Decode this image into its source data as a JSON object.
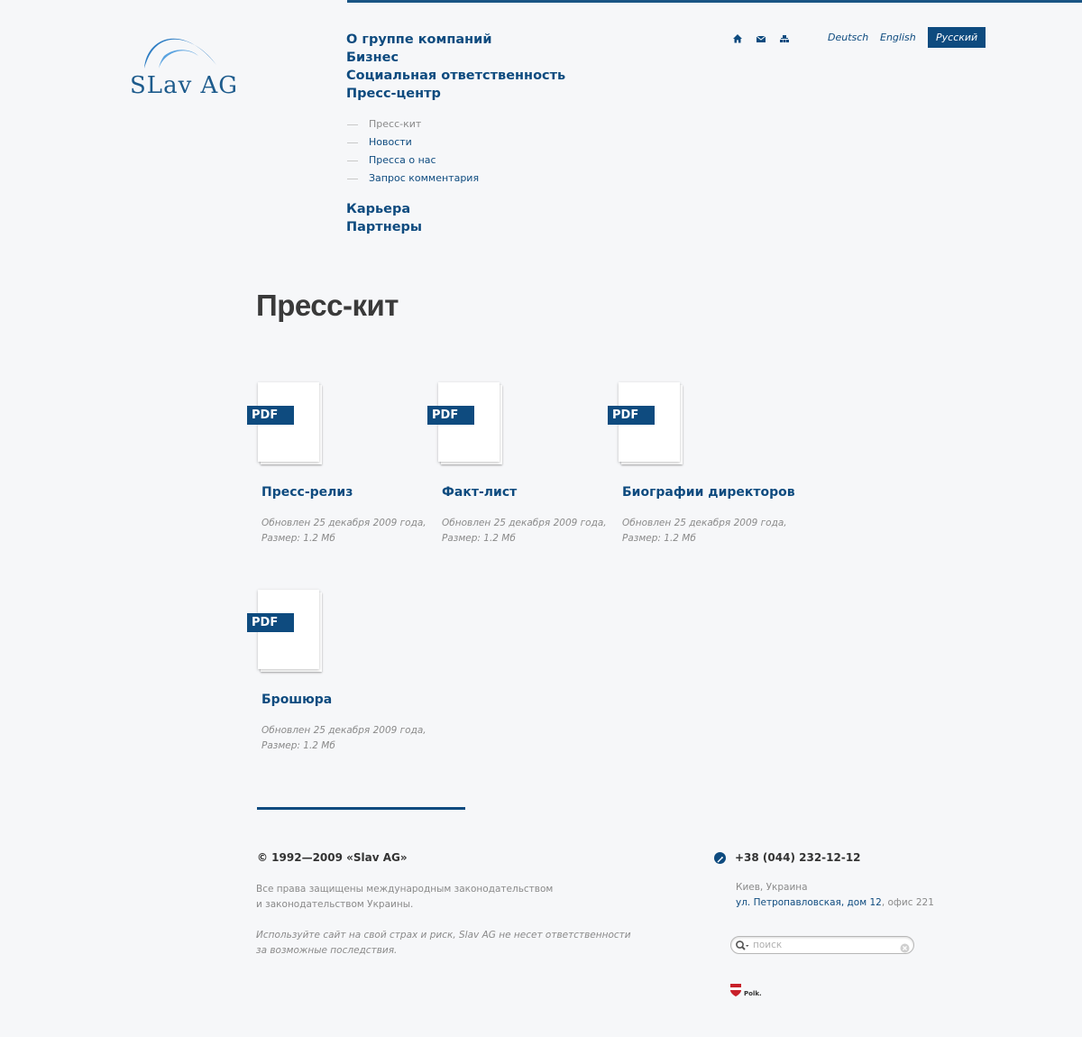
{
  "brand": {
    "logo_text": "SLav AG",
    "accent_color": "#0e4b7f"
  },
  "nav": {
    "items": [
      {
        "label": "О группе компаний"
      },
      {
        "label": "Бизнес"
      },
      {
        "label": "Социальная ответственность"
      },
      {
        "label": "Пресс-центр"
      }
    ],
    "subitems": [
      {
        "label": "Пресс-кит",
        "active": true
      },
      {
        "label": "Новости"
      },
      {
        "label": "Пресса о нас"
      },
      {
        "label": "Запрос комментария"
      }
    ],
    "items_after": [
      {
        "label": "Карьера"
      },
      {
        "label": "Партнеры"
      }
    ]
  },
  "utility_icons": [
    "home-icon",
    "mail-icon",
    "sitemap-icon"
  ],
  "languages": [
    {
      "label": "Deutsch"
    },
    {
      "label": "English"
    },
    {
      "label": "Русский",
      "active": true
    }
  ],
  "page": {
    "title": "Пресс-кит"
  },
  "documents": [
    {
      "badge": "PDF",
      "title": "Пресс-релиз",
      "meta_line1": "Обновлен 25 декабря 2009 года,",
      "meta_line2": "Размер: 1.2 Мб"
    },
    {
      "badge": "PDF",
      "title": "Факт-лист",
      "meta_line1": "Обновлен 25 декабря 2009 года,",
      "meta_line2": "Размер: 1.2 Мб"
    },
    {
      "badge": "PDF",
      "title": "Биографии директоров",
      "meta_line1": "Обновлен 25 декабря 2009 года,",
      "meta_line2": "Размер: 1.2 Мб"
    },
    {
      "badge": "PDF",
      "title": "Брошюра",
      "meta_line1": "Обновлен 25 декабря 2009 года,",
      "meta_line2": "Размер: 1.2 Мб"
    }
  ],
  "footer": {
    "copyright": "© 1992—2009 «Slav AG»",
    "rights_line1": "Все права защищены международным законодательством",
    "rights_line2": "и законодательством Украины.",
    "disclaimer_line1": "Используйте сайт на свой страх и риск, Slav AG не несет ответственности",
    "disclaimer_line2": "за возможные последствия.",
    "phone": "+38 (044) 232-12-12",
    "city": "Киев, Украина",
    "street": "ул. Петропавловская, дом 12",
    "office": ", офис 221",
    "search_placeholder": "поиск",
    "partner_logo_text": "Polk."
  }
}
